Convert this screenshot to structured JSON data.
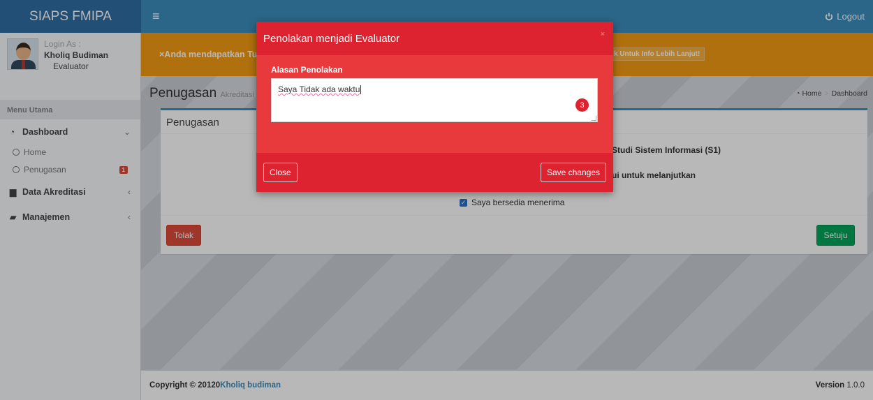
{
  "brand": {
    "title": "SIAPS FMIPA"
  },
  "topbar": {
    "menu_icon": "≡",
    "logout_label": "Logout"
  },
  "user": {
    "login_label": "Login As :",
    "name": "Kholiq Budiman",
    "role": "Evaluator"
  },
  "sidebar": {
    "header": "Menu Utama",
    "items": [
      {
        "label": "Dashboard",
        "icon": "dashboard-icon"
      },
      {
        "label": "Data Akreditasi",
        "icon": "inbox-icon"
      },
      {
        "label": "Manajemen",
        "icon": "book-icon"
      }
    ],
    "subitems": [
      {
        "label": "Home"
      },
      {
        "label": "Penugasan",
        "badge": "1"
      }
    ]
  },
  "alert": {
    "text": "×Anda mendapatkan Tu",
    "info_button": "k Untuk Info Lebih Lanjut!"
  },
  "page": {
    "title": "Penugasan",
    "subtitle": "Akreditasi"
  },
  "breadcrumb": {
    "home": "Home",
    "current": "Dashboard"
  },
  "box": {
    "title": "Penugasan",
    "line1": "Studi Sistem Informasi (S1)",
    "line2": "ui untuk melanjutkan",
    "checkbox_label": "Saya bersedia menerima",
    "tolak_label": "Tolak",
    "setuju_label": "Setuju"
  },
  "footer": {
    "copyright_prefix": "Copyright © 20120",
    "author": "Kholiq budiman",
    "version_label": "Version",
    "version_value": "1.0.0"
  },
  "modal": {
    "title": "Penolakan menjadi Evaluator",
    "close_x": "×",
    "field_label": "Alasan Penolakan",
    "textarea_value": "Saya Tidak ada waktu",
    "count_badge": "3",
    "close_label": "Close",
    "save_label": "Save changes"
  },
  "colors": {
    "primary": "#3c8dbc",
    "danger": "#dd2230",
    "warning": "#f39c12",
    "success": "#00a65a"
  }
}
